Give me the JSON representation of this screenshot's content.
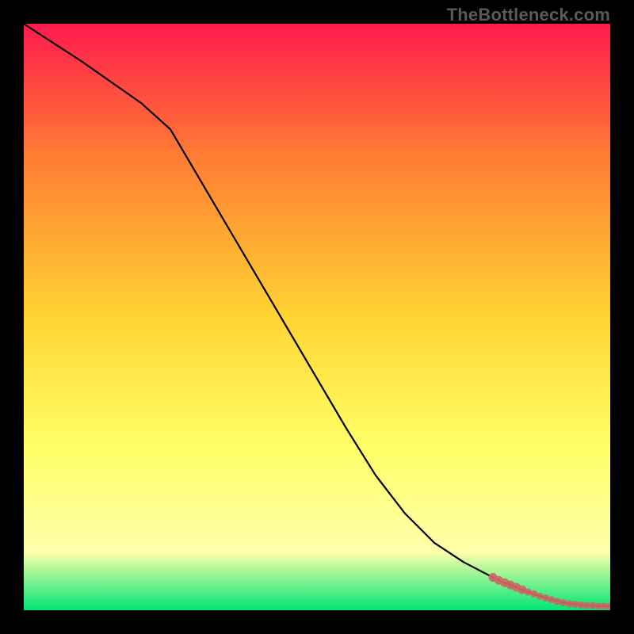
{
  "watermark": "TheBottleneck.com",
  "colors": {
    "background": "#000000",
    "gradient_top": "#ff1a4d",
    "gradient_mid_upper": "#ff7a33",
    "gradient_mid": "#ffd433",
    "gradient_mid_lower": "#ffff66",
    "gradient_pale": "#ffffaa",
    "gradient_bottom": "#00e673",
    "curve": "#000000",
    "markers": "#cc6666"
  },
  "chart_data": {
    "type": "line",
    "title": "",
    "xlabel": "",
    "ylabel": "",
    "xlim": [
      0,
      100
    ],
    "ylim": [
      0,
      100
    ],
    "grid": false,
    "legend": false,
    "series": [
      {
        "name": "bottleneck-curve",
        "x": [
          0,
          10,
          15,
          20,
          25,
          30,
          35,
          40,
          45,
          50,
          55,
          60,
          65,
          70,
          75,
          80,
          82,
          84,
          86,
          88,
          90,
          92,
          94,
          96,
          98,
          100
        ],
        "values": [
          100,
          93.5,
          90,
          86.5,
          82,
          73.5,
          65,
          56.5,
          48,
          39.5,
          31,
          23,
          16.5,
          11.5,
          8.2,
          5.6,
          4.7,
          3.9,
          3.1,
          2.4,
          1.8,
          1.3,
          1.0,
          0.8,
          0.7,
          0.7
        ]
      }
    ],
    "markers": {
      "name": "highlight-points",
      "x": [
        80,
        81,
        82,
        83,
        84,
        85,
        86,
        87,
        88,
        89,
        90,
        91,
        92,
        93,
        94,
        95,
        96,
        97,
        98,
        99,
        100
      ],
      "values": [
        5.6,
        5.1,
        4.7,
        4.3,
        3.9,
        3.5,
        3.1,
        2.8,
        2.4,
        2.1,
        1.8,
        1.5,
        1.3,
        1.1,
        1.0,
        0.9,
        0.8,
        0.8,
        0.7,
        0.7,
        0.7
      ]
    }
  }
}
